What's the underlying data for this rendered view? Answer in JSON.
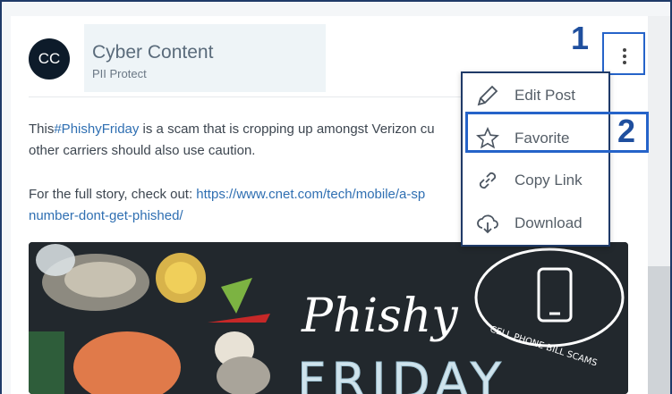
{
  "author": {
    "initials": "CC",
    "name": "Cyber Content",
    "subtitle": "PII Protect"
  },
  "post": {
    "line1_prefix": "This",
    "hashtag": "#PhishyFriday",
    "line1_suffix": " is a scam that is cropping up amongst Verizon cu",
    "line2": "other carriers should also use caution.",
    "line3_prefix": "For the full story, check out: ",
    "link_part1": "https://www.cnet.com/tech/mobile/a-sp",
    "link_part2": "number-dont-get-phished/",
    "image": {
      "script_title": "Phishy",
      "block_title": "FRIDAY",
      "badge_text": "CELL PHONE BILL SCAMS"
    }
  },
  "menu": {
    "items": [
      {
        "label": "Edit Post",
        "icon": "pencil-icon"
      },
      {
        "label": "Favorite",
        "icon": "star-icon"
      },
      {
        "label": "Copy Link",
        "icon": "link-icon"
      },
      {
        "label": "Download",
        "icon": "cloud-download-icon"
      }
    ]
  },
  "callouts": {
    "one": "1",
    "two": "2"
  },
  "colors": {
    "accent": "#2563c9",
    "link": "#2f6fb2",
    "callout": "#1f4f9e"
  }
}
